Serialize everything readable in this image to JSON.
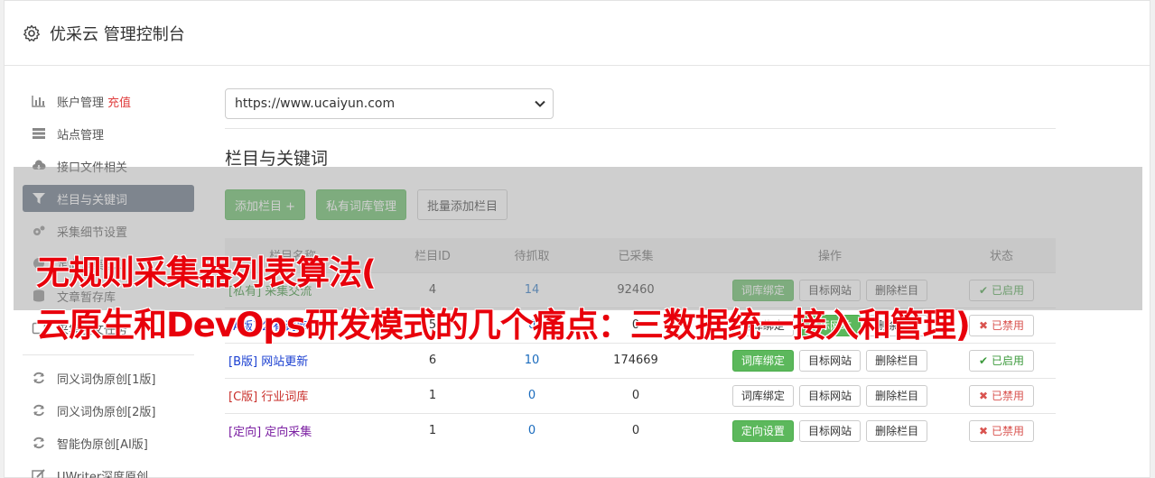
{
  "header": {
    "title": "优采云 管理控制台"
  },
  "sidebar": {
    "items": [
      {
        "label": "账户管理",
        "extra": "充值",
        "icon": "bar-chart-icon"
      },
      {
        "label": "站点管理",
        "icon": "server-icon"
      },
      {
        "label": "接口文件相关",
        "icon": "cloud-download-icon"
      },
      {
        "label": "栏目与关键词",
        "icon": "filter-icon"
      },
      {
        "label": "采集细节设置",
        "icon": "cogs-icon"
      },
      {
        "label": "定向采集规则",
        "icon": "globe-icon"
      },
      {
        "label": "文章暂存库",
        "icon": "database-icon"
      },
      {
        "label": "采集发文任务",
        "icon": "window-icon"
      },
      {
        "label": "同义词伪原创[1版]",
        "icon": "refresh-icon"
      },
      {
        "label": "同义词伪原创[2版]",
        "icon": "refresh-icon"
      },
      {
        "label": "智能伪原创[AI版]",
        "icon": "refresh-icon"
      },
      {
        "label": "UWriter深度原创",
        "icon": "edit-icon"
      }
    ]
  },
  "main": {
    "site_select": "https://www.ucaiyun.com",
    "section_title": "栏目与关键词",
    "buttons": {
      "add_column": "添加栏目 +",
      "private_lib": "私有词库管理",
      "batch_add": "批量添加栏目"
    },
    "table": {
      "headers": {
        "name": "栏目名称",
        "id": "栏目ID",
        "pending": "待抓取",
        "collected": "已采集",
        "ops": "操作",
        "status": "状态"
      },
      "rows": [
        {
          "name": "[私有] 采集交流",
          "id": "4",
          "pending": "14",
          "collected": "92460",
          "op1": "词库绑定",
          "op2": "目标网站",
          "op3": "删除栏目",
          "status": "已启用"
        },
        {
          "name": "[A版] 公有词库",
          "id": "5",
          "pending": "0",
          "collected": "0",
          "op1": "词库绑定",
          "op2": "目标网站",
          "op3": "删除栏目",
          "status": "已禁用"
        },
        {
          "name": "[B版] 网站更新",
          "id": "6",
          "pending": "10",
          "collected": "174669",
          "op1": "词库绑定",
          "op2": "目标网站",
          "op3": "删除栏目",
          "status": "已启用"
        },
        {
          "name": "[C版] 行业词库",
          "id": "1",
          "pending": "0",
          "collected": "0",
          "op1": "词库绑定",
          "op2": "目标网站",
          "op3": "删除栏目",
          "status": "已禁用"
        },
        {
          "name": "[定向] 定向采集",
          "id": "1",
          "pending": "0",
          "collected": "0",
          "op1": "定向设置",
          "op2": "目标网站",
          "op3": "删除栏目",
          "status": "已禁用"
        }
      ]
    }
  },
  "overlay": {
    "line1": "无规则采集器列表算法(",
    "line2": "云原生和DevOps研发模式的几个痛点：三数据统一接入和管理)"
  }
}
